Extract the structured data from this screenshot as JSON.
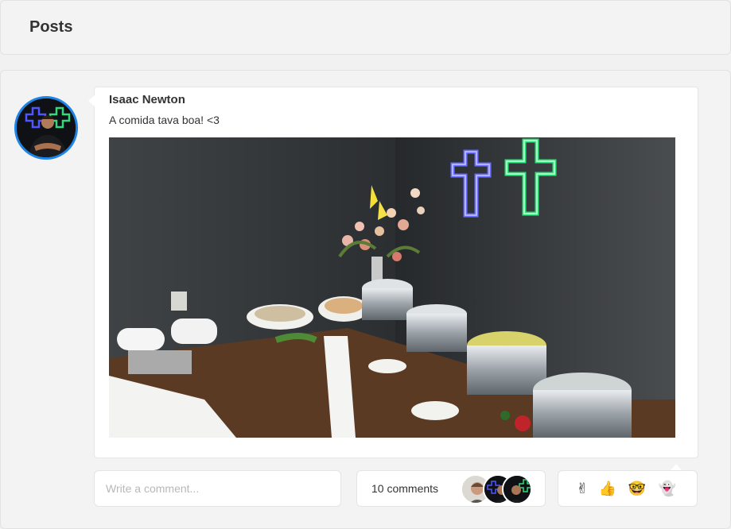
{
  "header": {
    "title": "Posts"
  },
  "post": {
    "author": "Isaac Newton",
    "text": "A comida tava boa! <3"
  },
  "comment_input": {
    "placeholder": "Write a comment..."
  },
  "comments": {
    "count_label": "10 comments"
  },
  "reactions": [
    {
      "name": "hand-icon",
      "glyph": "✌"
    },
    {
      "name": "thumbs-up-icon",
      "glyph": "👍"
    },
    {
      "name": "nerd-face-icon",
      "glyph": "🤓"
    },
    {
      "name": "ghost-icon",
      "glyph": "👻"
    }
  ],
  "colors": {
    "avatar_ring": "#1e84e6",
    "neon_blue": "#5a5cff",
    "neon_green": "#39e07a"
  }
}
